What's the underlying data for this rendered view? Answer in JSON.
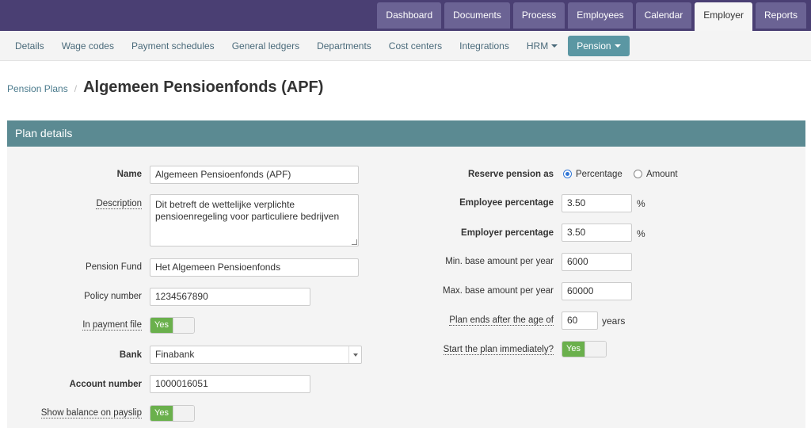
{
  "topnav": {
    "tabs": [
      {
        "label": "Dashboard"
      },
      {
        "label": "Documents"
      },
      {
        "label": "Process"
      },
      {
        "label": "Employees"
      },
      {
        "label": "Calendar"
      },
      {
        "label": "Employer",
        "active": true
      },
      {
        "label": "Reports"
      }
    ]
  },
  "subnav": {
    "items": [
      {
        "label": "Details"
      },
      {
        "label": "Wage codes"
      },
      {
        "label": "Payment schedules"
      },
      {
        "label": "General ledgers"
      },
      {
        "label": "Departments"
      },
      {
        "label": "Cost centers"
      },
      {
        "label": "Integrations"
      },
      {
        "label": "HRM"
      },
      {
        "label": "Pension",
        "active": true
      }
    ]
  },
  "breadcrumb": {
    "parent": "Pension Plans",
    "separator": "/",
    "title": "Algemeen Pensioenfonds (APF)"
  },
  "panel": {
    "title": "Plan details"
  },
  "form": {
    "name": {
      "label": "Name",
      "value": "Algemeen Pensioenfonds (APF)"
    },
    "description": {
      "label": "Description",
      "value": "Dit betreft de wettelijke verplichte pensioenregeling voor particuliere bedrijven"
    },
    "pension_fund": {
      "label": "Pension Fund",
      "value": "Het Algemeen Pensioenfonds"
    },
    "policy_number": {
      "label": "Policy number",
      "value": "1234567890"
    },
    "in_payment_file": {
      "label": "In payment file",
      "toggle": "Yes"
    },
    "bank": {
      "label": "Bank",
      "value": "Finabank"
    },
    "account_number": {
      "label": "Account number",
      "value": "1000016051"
    },
    "show_balance": {
      "label": "Show balance on payslip",
      "toggle": "Yes"
    },
    "reserve_pension": {
      "label": "Reserve pension as",
      "opt1": "Percentage",
      "opt2": "Amount"
    },
    "employee_pct": {
      "label": "Employee percentage",
      "value": "3.50",
      "unit": "%"
    },
    "employer_pct": {
      "label": "Employer percentage",
      "value": "3.50",
      "unit": "%"
    },
    "min_base": {
      "label": "Min. base amount per year",
      "value": "6000"
    },
    "max_base": {
      "label": "Max. base amount per year",
      "value": "60000"
    },
    "plan_ends": {
      "label": "Plan ends after the age of",
      "value": "60",
      "unit": "years"
    },
    "start_immediately": {
      "label": "Start the plan immediately?",
      "toggle": "Yes"
    }
  },
  "colors": {
    "topbar": "#4a3f73",
    "tab": "#6b6394",
    "accent": "#5b97a3",
    "panel_header": "#5b8a92",
    "toggle_on": "#6ab04c"
  }
}
